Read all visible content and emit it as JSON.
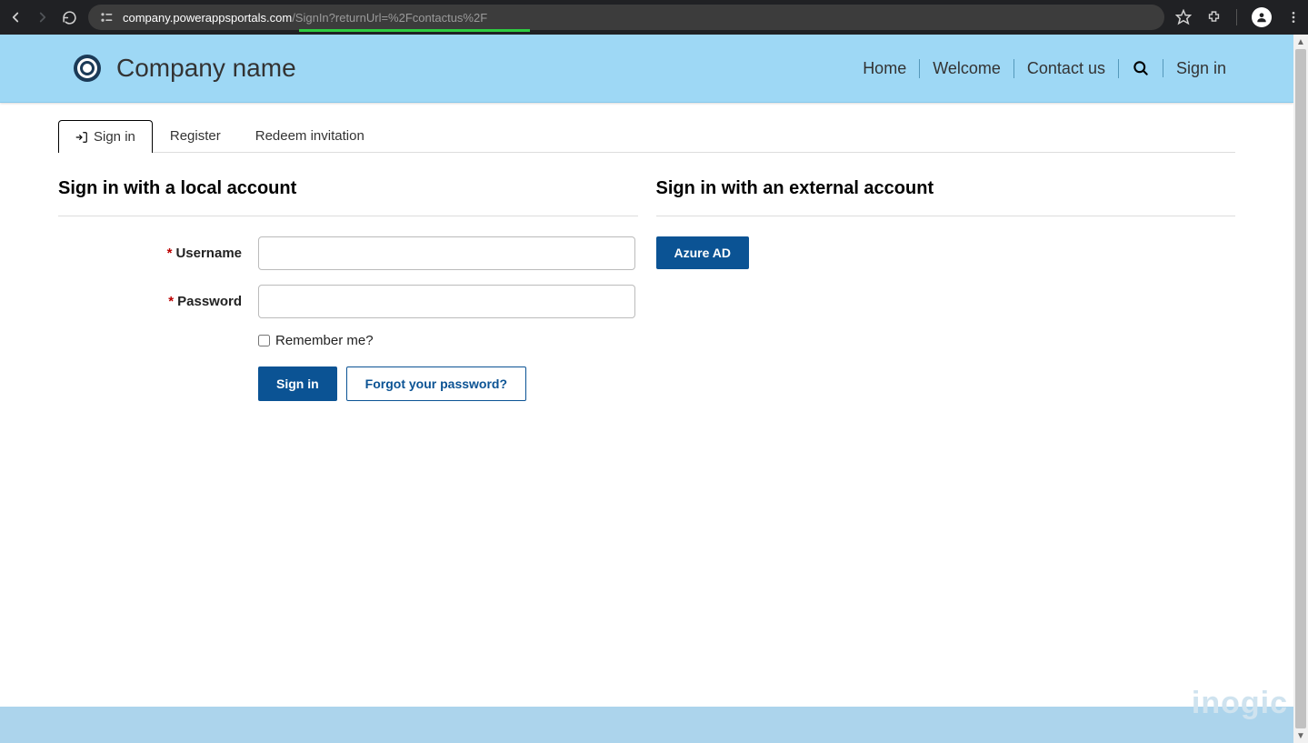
{
  "browser": {
    "url_host": "company.powerappsportals.com",
    "url_path": "/SignIn?returnUrl=%2Fcontactus%2F"
  },
  "header": {
    "brand": "Company name",
    "nav": {
      "home": "Home",
      "welcome": "Welcome",
      "contact": "Contact us",
      "signin": "Sign in"
    }
  },
  "tabs": {
    "signin": "Sign in",
    "register": "Register",
    "redeem": "Redeem invitation"
  },
  "local": {
    "heading": "Sign in with a local account",
    "username_label": "Username",
    "password_label": "Password",
    "remember_label": "Remember me?",
    "submit": "Sign in",
    "forgot": "Forgot your password?"
  },
  "external": {
    "heading": "Sign in with an external account",
    "azure": "Azure AD"
  },
  "watermark": "inogic"
}
